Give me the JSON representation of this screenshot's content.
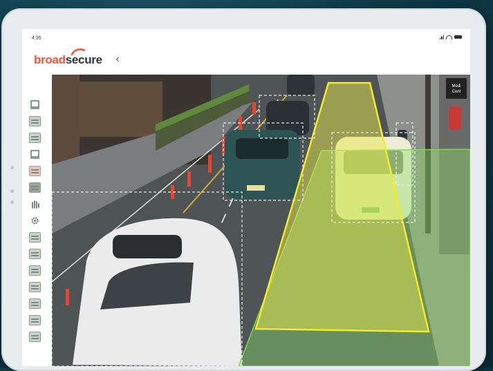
{
  "device": {
    "type": "tablet"
  },
  "status_bar": {
    "time": "4:35"
  },
  "app": {
    "brand": {
      "part1": "broad",
      "part2": "secure"
    },
    "back_icon": "chevron-left-icon",
    "accent_color": "#e85a35"
  },
  "toolbar": {
    "tools": [
      {
        "name": "tool-region-draw",
        "icon": "region-draw-icon"
      },
      {
        "name": "tool-grid-1",
        "icon": "grid-icon"
      },
      {
        "name": "tool-grid-2",
        "icon": "grid-icon"
      },
      {
        "name": "tool-region-draw-2",
        "icon": "region-draw-icon"
      },
      {
        "name": "tool-grid-3",
        "icon": "grid-icon"
      },
      {
        "name": "tool-grid-4",
        "icon": "grid-icon"
      },
      {
        "name": "tool-gesture",
        "icon": "hand-icon"
      },
      {
        "name": "tool-settings",
        "icon": "gear-icon"
      },
      {
        "name": "tool-grid-5",
        "icon": "grid-icon"
      },
      {
        "name": "tool-grid-6",
        "icon": "grid-icon"
      },
      {
        "name": "tool-grid-7",
        "icon": "grid-icon"
      },
      {
        "name": "tool-grid-8",
        "icon": "grid-icon"
      },
      {
        "name": "tool-grid-9",
        "icon": "grid-icon"
      },
      {
        "name": "tool-grid-10",
        "icon": "grid-icon"
      },
      {
        "name": "tool-grid-11",
        "icon": "grid-icon"
      }
    ]
  },
  "camera_view": {
    "scene": "street-traffic-feed",
    "zone_colors": {
      "yellow_zone": "#e8e84a",
      "green_zone": "#8fe06a"
    },
    "sign_text": "Medi Cent"
  }
}
